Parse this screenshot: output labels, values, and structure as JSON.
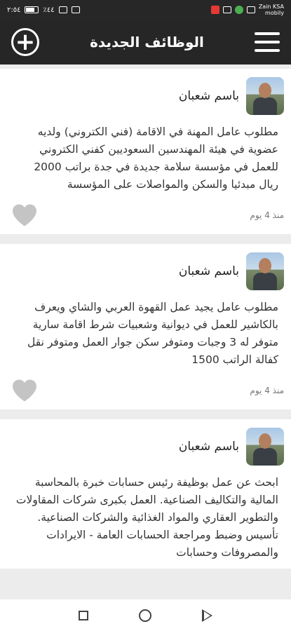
{
  "status_bar": {
    "time_left": "٢:٥٤",
    "battery": "٪٤٤",
    "carrier_line1": "Zain KSA",
    "carrier_line2": "mobily"
  },
  "app_bar": {
    "title": "الوظائف الجديدة",
    "add_icon": "plus-circle-icon",
    "menu_icon": "hamburger-menu-icon"
  },
  "posts": [
    {
      "author": "باسم شعبان",
      "text": "مطلوب عامل المهنة في الاقامة (فني الكتروني) ولديه عضوية في هيئة المهندسين السعوديين كفني الكتروني للعمل في مؤسسة سلامة جديدة في جدة براتب 2000 ريال مبدئيا والسكن والمواصلات على المؤسسة",
      "time": "منذ 4 يوم"
    },
    {
      "author": "باسم شعبان",
      "text": "مطلوب عامل يجيد عمل القهوة العربي والشاي ويعرف بالكاشير للعمل في ديوانية وشعبيات شرط اقامة سارية متوفر له 3 وجبات ومتوفر سكن جوار العمل ومتوفر نقل كفالة الراتب 1500",
      "time": "منذ 4 يوم"
    },
    {
      "author": "باسم شعبان",
      "text": "ابحث عن عمل بوظيفة رئيس حسابات خبرة بالمحاسبة المالية والتكاليف الصناعية. العمل بكبرى شركات المقاولات والتطوير العقاري والمواد الغذائية والشركات الصناعية. تأسيس وضبط ومراجعة الحسابات العامة - الايرادات والمصروفات وحسابات",
      "time": ""
    }
  ],
  "colors": {
    "app_bar": "#262626",
    "heart": "#c4c4c4",
    "background": "#ececec"
  }
}
